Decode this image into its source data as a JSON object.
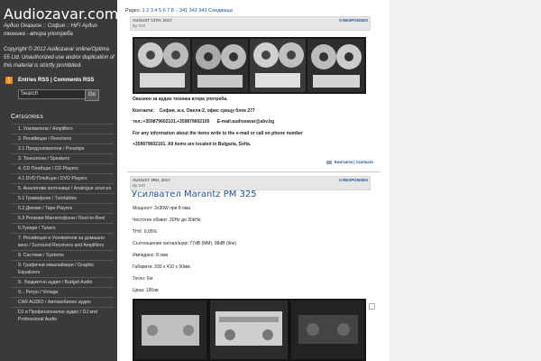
{
  "site": {
    "title": "Audiozavar.com",
    "tagline": "Аудио Оказион :: София :: HiFi Аудио техника - втора употреба",
    "copyright": "Copyright © 2012 Audiozavar online/Optima 55 Ltd. Unauthorized use and/or duplication of this material is strictly prohibited."
  },
  "rss": {
    "entries": "Entries RSS",
    "separator": " | ",
    "comments": "Comments RSS"
  },
  "search": {
    "value": "Search",
    "button": "Go"
  },
  "categories": {
    "heading": "Categories",
    "items": [
      "1. Усилватели / Amplifiers",
      "2. Ресийвъри / Receivers",
      "2.1 Предусилватели / Preamps",
      "3. Тонколони / Speakers",
      "4. CD Плейъри / CD Players",
      "4.1 DVD Плейъри / DVD Players",
      "5. Аналогови източници / Analogue sources",
      "5.1 Грамофони / Turntables",
      "5.2 Декове / Tape Players",
      "5.3 Ролкови Магнетофони / Reel-to-Reel",
      "6.Тунери / Tuners",
      "7. Ресийвъри и Усилватели за домашно кино / Surround Receivers and Amplifiers",
      "8. Системи / Systems",
      "9. Графични еквалайзери / Graphic Equalizers",
      "9.. Бюджетно аудио / Budget Audio",
      "9... Ретро / Vintage",
      "CAR AUDIO / Автомобилно аудио",
      "DJ и Професионално аудио / DJ and Professional Audio"
    ]
  },
  "pagination": {
    "prefix": "Pages:",
    "links": "1 2 3 4 5 6 7 8 ...341 342 343 Следваща"
  },
  "post1": {
    "date": "AUGUST 13TH, 2017",
    "by": "By IVO",
    "responses": "0 RESPONSES",
    "headline": "Оказион за аудио техника втора употреба.",
    "contacts": "Контакти:    София, ж.к. Овеля-2, офис срещу блок 277",
    "phones": "тел.:+359879602101,+359879602100      E-mail:audiozavar@abv.bg",
    "info": "For any information about the items write to the e-mail or call on phone number",
    "location": "+359879602101. All items are located in Bulgaria, Sofia.",
    "footer": "Контакти | Contacts"
  },
  "post2": {
    "date": "AUGUST 3RD, 2017",
    "by": "By IVO",
    "responses": "0 RESPONSES",
    "title": "Усилвател Marantz PM 325",
    "specs": [
      "Мощност: 2x30W  при 8 ома",
      "Честотен обхват: 20Hz до 30kHz",
      "THX: 0.05%",
      "Съотношение сигнал/шум: 77dB (MM), 98dB (line)",
      "Импеданс: 8 ома",
      "Габарити: 330 x 410 x 90мм",
      "Тегло: 6кг",
      "Цена: 190лв"
    ]
  },
  "colors": {
    "sidebar": "#3a3a3a",
    "link": "#1e4f9a",
    "rss": "#f28a1e"
  }
}
